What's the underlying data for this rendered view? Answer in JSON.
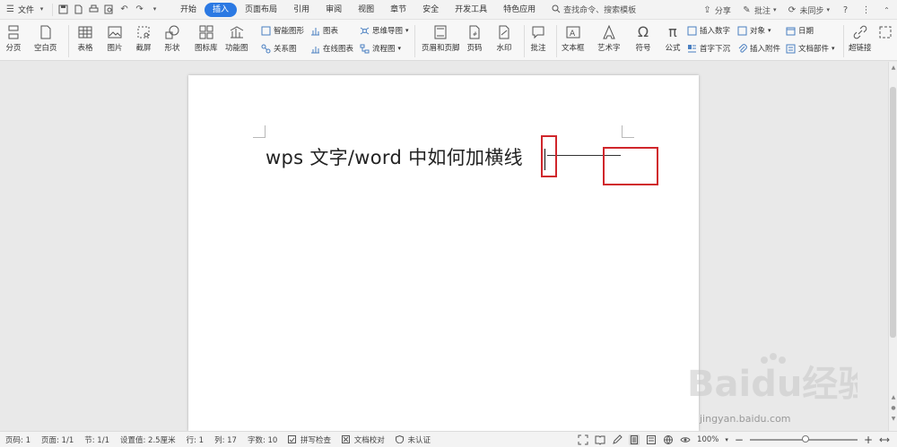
{
  "menubar": {
    "file_label": "文件",
    "tabs": [
      {
        "label": "开始"
      },
      {
        "label": "插入",
        "active": true
      },
      {
        "label": "页面布局"
      },
      {
        "label": "引用"
      },
      {
        "label": "审阅"
      },
      {
        "label": "视图"
      },
      {
        "label": "章节"
      },
      {
        "label": "安全"
      },
      {
        "label": "开发工具"
      },
      {
        "label": "特色应用"
      }
    ],
    "search_label": "查找命令、搜索模板",
    "share_label": "分享",
    "comment_label": "批注",
    "sync_label": "未同步"
  },
  "ribbon": {
    "page_break": "分页",
    "blank_page": "空白页",
    "table": "表格",
    "picture": "图片",
    "screenshot": "截屏",
    "shape": "形状",
    "icon_lib": "图标库",
    "func_chart": "功能图",
    "smart_shape": "智能图形",
    "chart": "图表",
    "mind_map": "思维导图",
    "relation": "关系图",
    "online_chart": "在线图表",
    "flowchart": "流程图",
    "header_footer": "页眉和页脚",
    "page_num": "页码",
    "watermark": "水印",
    "annotation": "批注",
    "textbox": "文本框",
    "wordart": "艺术字",
    "symbol": "符号",
    "formula": "公式",
    "insert_number": "插入数字",
    "object": "对象",
    "dropcap": "首字下沉",
    "attachment": "插入附件",
    "date": "日期",
    "doc_parts": "文档部件",
    "hyperlink": "超链接"
  },
  "document": {
    "text": "wps 文字/word 中如何加横线"
  },
  "watermark": {
    "brand": "Baidu经验",
    "url": "jingyan.baidu.com"
  },
  "status": {
    "page_num": "页码: 1",
    "pages": "页面: 1/1",
    "section": "节: 1/1",
    "setting": "设置值: 2.5厘米",
    "row": "行: 1",
    "col": "列: 17",
    "words": "字数: 10",
    "spell": "拼写检查",
    "proof": "文档校对",
    "auth": "未认证",
    "zoom": "100%"
  }
}
